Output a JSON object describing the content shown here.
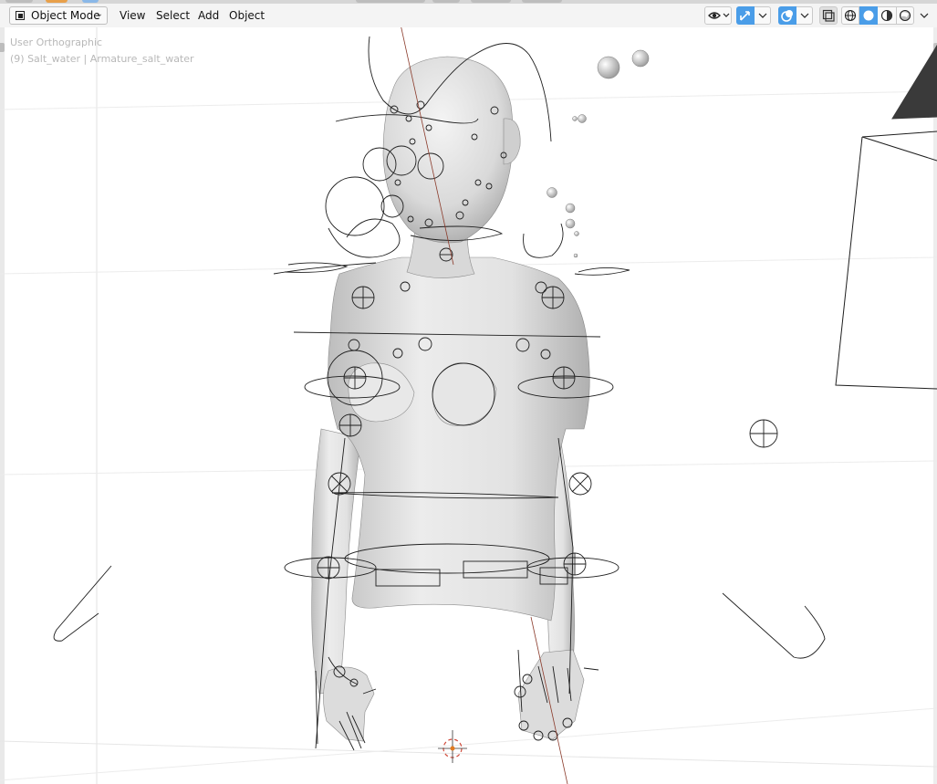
{
  "header": {
    "mode_label": "Object Mode",
    "menus": [
      "View",
      "Select",
      "Add",
      "Object"
    ]
  },
  "viewport": {
    "view_name": "User Orthographic",
    "object_info": "(9) Salt_water | Armature_salt_water",
    "viewport_shading": "solid",
    "accent_color": "#4a9de8"
  },
  "icons": {
    "mode": "object-mode-icon",
    "visibility": "eye-icon",
    "gizmo": "gizmo-icon",
    "overlay": "overlay-icon",
    "xray": "xray-icon",
    "wireframe_shading": "wireframe-shading-icon",
    "solid_shading": "solid-shading-icon",
    "material_shading": "material-shading-icon",
    "rendered_shading": "rendered-shading-icon"
  }
}
